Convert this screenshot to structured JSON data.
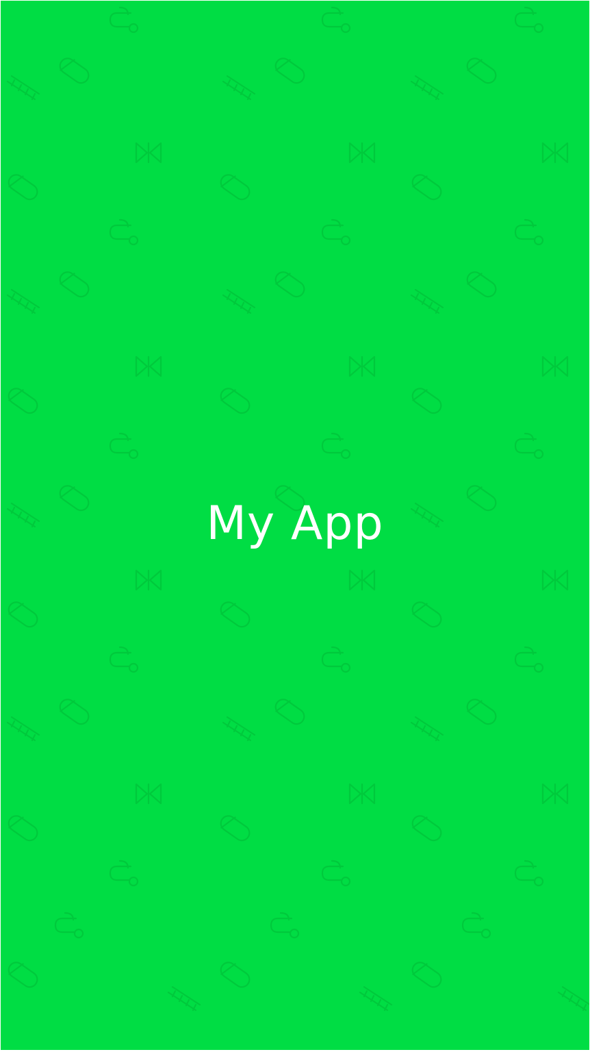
{
  "splash": {
    "app_title": "My App",
    "background_color": "#00dd44",
    "title_color": "#ffffff",
    "pattern": {
      "color": "#00c63c",
      "icons": [
        "link-hook-icon",
        "pill-icon",
        "chain-icon",
        "bowtie-logo-icon"
      ]
    }
  }
}
